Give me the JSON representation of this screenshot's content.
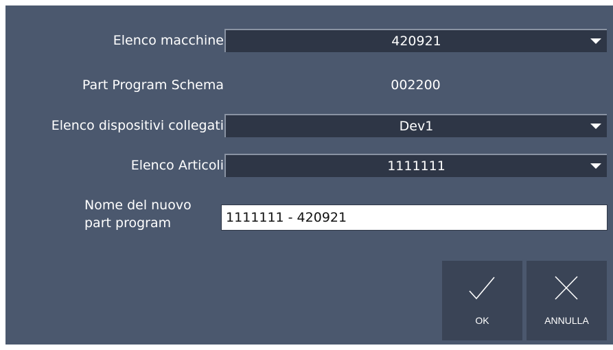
{
  "form": {
    "machine_list_label": "Elenco macchine",
    "machine_list_value": "420921",
    "schema_label": "Part Program Schema",
    "schema_value": "002200",
    "devices_label": "Elenco dispositivi collegati",
    "devices_value": "Dev1",
    "articles_label": "Elenco Articoli",
    "articles_value": "1111111",
    "new_name_label": "Nome del nuovo part program",
    "new_name_value": "1111111 - 420921"
  },
  "actions": {
    "ok_label": "OK",
    "cancel_label": "ANNULLA"
  },
  "icons": {
    "dropdown": "chevron-down-icon",
    "ok": "checkmark-icon",
    "cancel": "close-icon"
  },
  "colors": {
    "dialog_bg": "#4b586e",
    "combo_bg": "#2e3646",
    "button_bg": "#3a4456",
    "text": "#ffffff"
  }
}
